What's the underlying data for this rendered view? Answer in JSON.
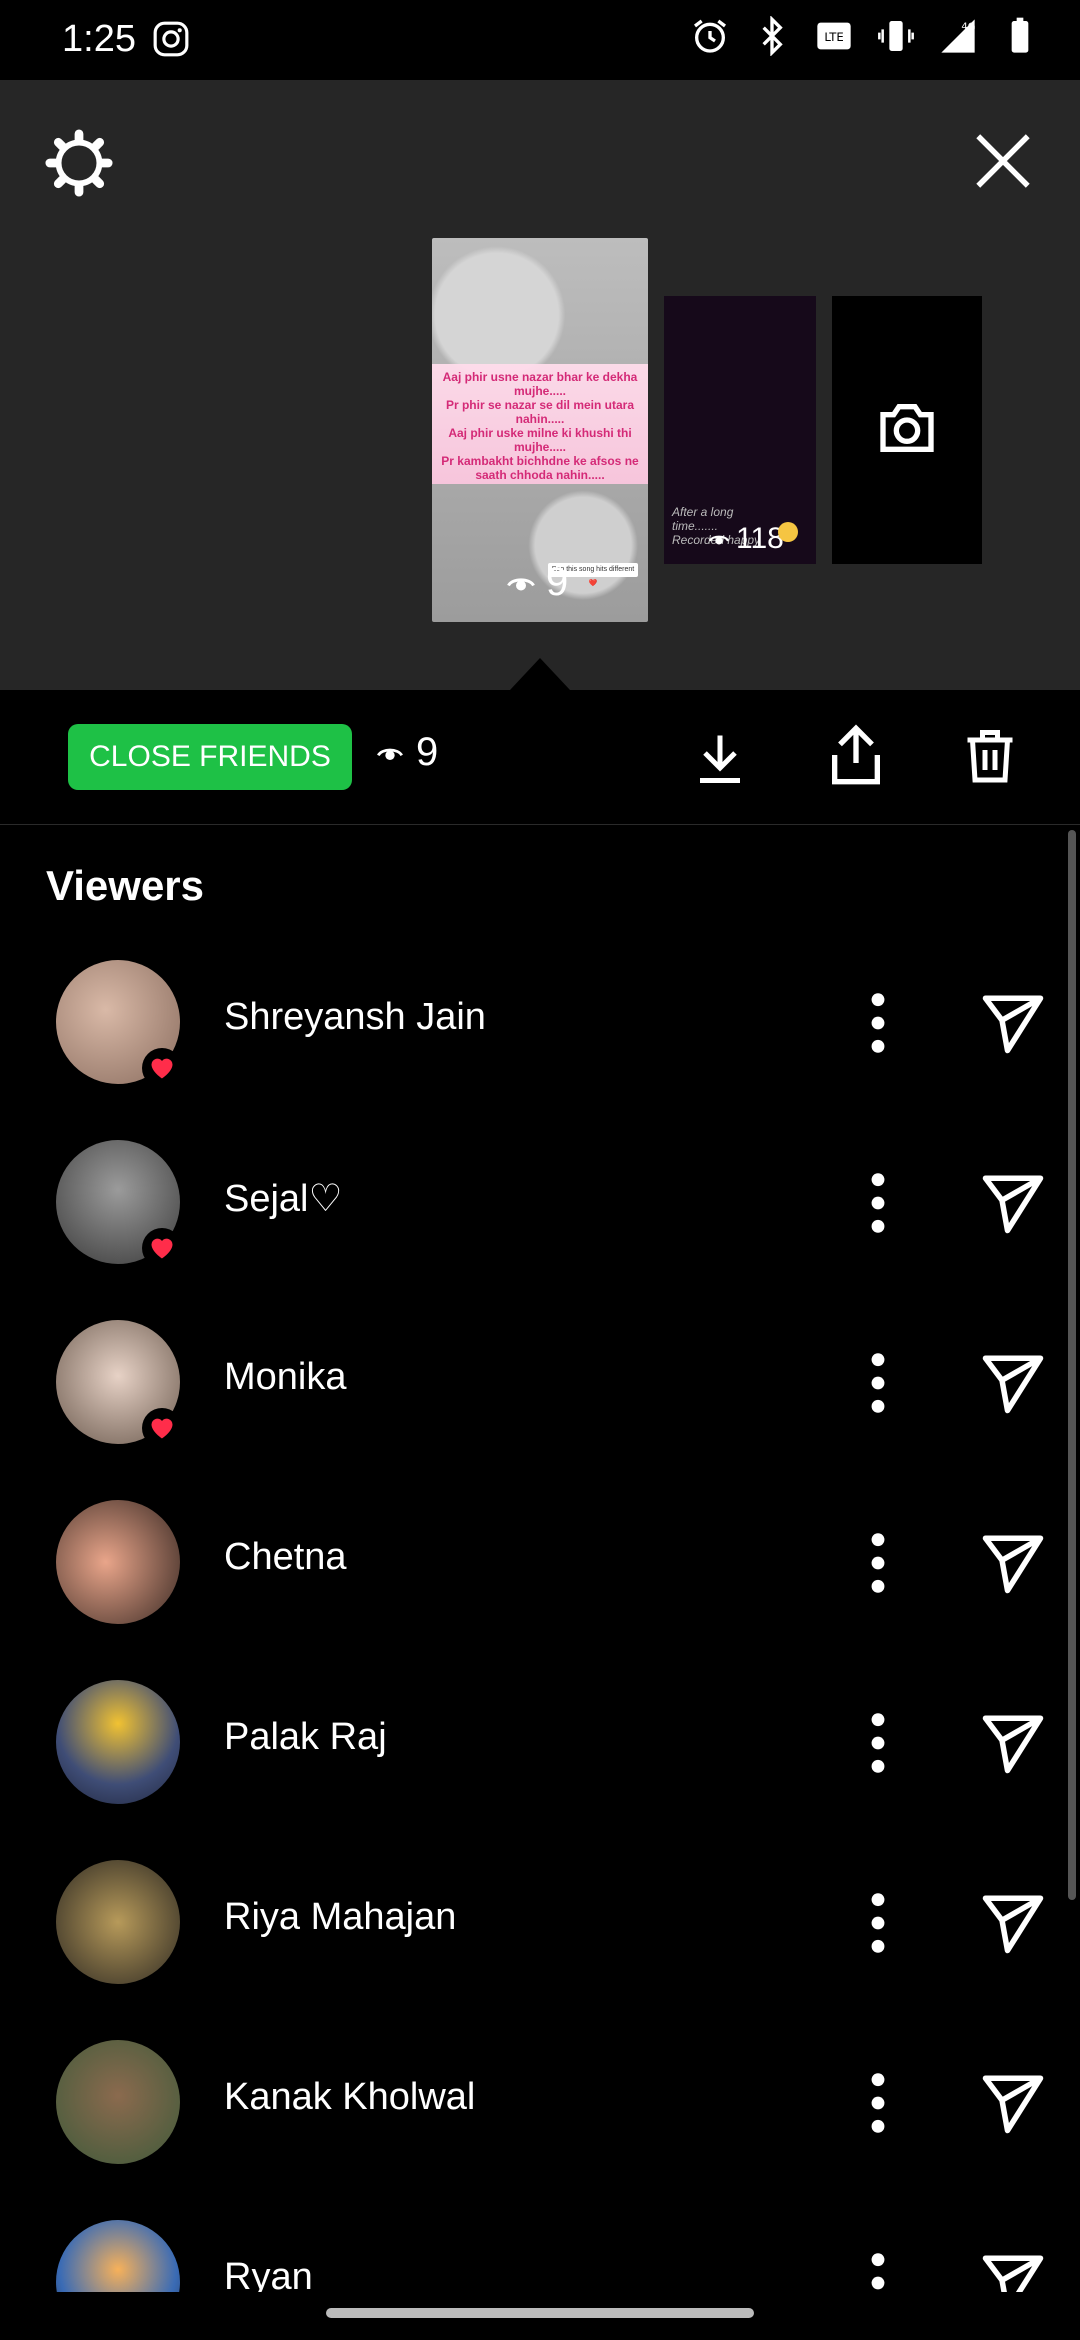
{
  "status_bar": {
    "time": "1:25",
    "network": "4G"
  },
  "story": {
    "main_text": "Aaj phir usne nazar bhar ke dekha mujhe.....\nPr phir se nazar se dil mein utara nahin.....\nAaj phir uske milne ki khushi thi mujhe.....\nPr kambakht bichhdne ke afsos ne saath chhoda nahin.....",
    "main_tag": "Boo this song hits different ❤️",
    "main_views": "9",
    "second_caption": "After a long time.......\nRecorded happy",
    "second_views": "118"
  },
  "action_bar": {
    "close_friends_label": "CLOSE FRIENDS",
    "views": "9"
  },
  "viewers": {
    "title": "Viewers",
    "items": [
      {
        "name": "Shreyansh Jain",
        "liked": true
      },
      {
        "name": "Sejal♡",
        "liked": true
      },
      {
        "name": "Monika",
        "liked": true
      },
      {
        "name": "Chetna",
        "liked": false
      },
      {
        "name": "Palak Raj",
        "liked": false
      },
      {
        "name": "Riya Mahajan",
        "liked": false
      },
      {
        "name": "Kanak Kholwal",
        "liked": false
      },
      {
        "name": "Ryan",
        "liked": false
      }
    ]
  },
  "colors": {
    "accent_green": "#1ec146",
    "heart_red": "#ff2d4a",
    "panel_bg": "#262626"
  }
}
